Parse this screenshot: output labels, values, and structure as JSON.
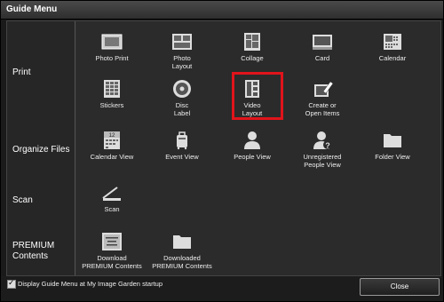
{
  "window": {
    "title": "Guide Menu"
  },
  "sections": {
    "print": {
      "label": "Print",
      "items": [
        {
          "label": "Photo Print",
          "icon": "photo-print-icon"
        },
        {
          "label": "Photo\nLayout",
          "icon": "photo-layout-icon"
        },
        {
          "label": "Collage",
          "icon": "collage-icon"
        },
        {
          "label": "Card",
          "icon": "card-icon"
        },
        {
          "label": "Calendar",
          "icon": "calendar-icon"
        },
        {
          "label": "Stickers",
          "icon": "stickers-icon"
        },
        {
          "label": "Disc\nLabel",
          "icon": "disc-label-icon"
        },
        {
          "label": "Video\nLayout",
          "icon": "video-layout-icon",
          "selected": true
        },
        {
          "label": "Create or\nOpen Items",
          "icon": "create-open-items-icon"
        }
      ]
    },
    "organize": {
      "label": "Organize Files",
      "items": [
        {
          "label": "Calendar View",
          "icon": "calendar-view-icon",
          "icon_text": "12"
        },
        {
          "label": "Event View",
          "icon": "event-view-icon"
        },
        {
          "label": "People View",
          "icon": "people-view-icon"
        },
        {
          "label": "Unregistered\nPeople View",
          "icon": "unregistered-people-icon"
        },
        {
          "label": "Folder View",
          "icon": "folder-view-icon"
        }
      ]
    },
    "scan": {
      "label": "Scan",
      "items": [
        {
          "label": "Scan",
          "icon": "scan-icon"
        }
      ]
    },
    "premium": {
      "label": "PREMIUM\nContents",
      "items": [
        {
          "label": "Download\nPREMIUM Contents",
          "icon": "download-premium-icon"
        },
        {
          "label": "Downloaded\nPREMIUM Contents",
          "icon": "downloaded-premium-icon"
        }
      ]
    }
  },
  "footer": {
    "startup_checkbox_label": "Display Guide Menu at My Image Garden startup",
    "startup_checked": true,
    "close_label": "Close"
  },
  "colors": {
    "selection": "#e0141b",
    "background": "#2b2b2b"
  }
}
